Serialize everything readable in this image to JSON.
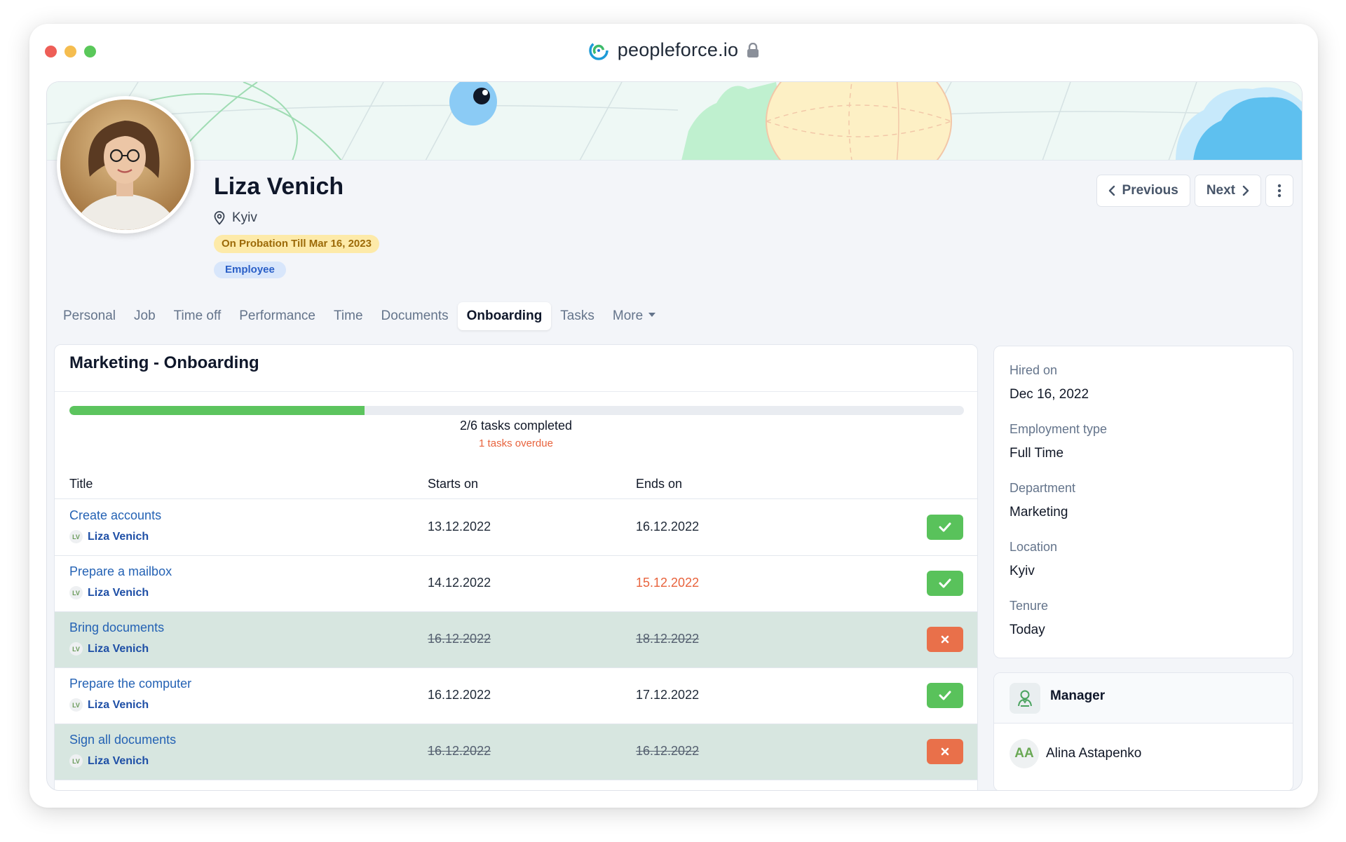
{
  "browser": {
    "url": "peopleforce.io"
  },
  "profile": {
    "name": "Liza Venich",
    "location": "Kyiv",
    "probation": "On Probation Till Mar 16, 2023",
    "type_badge": "Employee"
  },
  "nav": {
    "previous": "Previous",
    "next": "Next"
  },
  "tabs": [
    {
      "label": "Personal"
    },
    {
      "label": "Job"
    },
    {
      "label": "Time off"
    },
    {
      "label": "Performance"
    },
    {
      "label": "Time"
    },
    {
      "label": "Documents"
    },
    {
      "label": "Onboarding"
    },
    {
      "label": "Tasks"
    },
    {
      "label": "More"
    }
  ],
  "active_tab": "Onboarding",
  "onboarding": {
    "title": "Marketing - Onboarding",
    "progress_fraction": 0.33,
    "progress_text": "2/6 tasks completed",
    "overdue_text": "1 tasks overdue",
    "columns": {
      "title": "Title",
      "starts": "Starts on",
      "ends": "Ends on"
    },
    "tasks": [
      {
        "title": "Create accounts",
        "assignee_initials": "LV",
        "assignee": "Liza Venich",
        "starts": "13.12.2022",
        "ends": "16.12.2022",
        "status": "done"
      },
      {
        "title": "Prepare a mailbox",
        "assignee_initials": "LV",
        "assignee": "Liza Venich",
        "starts": "14.12.2022",
        "ends": "15.12.2022",
        "status": "done",
        "ends_overdue": true
      },
      {
        "title": "Bring documents",
        "assignee_initials": "LV",
        "assignee": "Liza Venich",
        "starts": "16.12.2022",
        "ends": "18.12.2022",
        "status": "cancelled"
      },
      {
        "title": "Prepare the computer",
        "assignee_initials": "LV",
        "assignee": "Liza Venich",
        "starts": "16.12.2022",
        "ends": "17.12.2022",
        "status": "done"
      },
      {
        "title": "Sign all documents",
        "assignee_initials": "LV",
        "assignee": "Liza Venich",
        "starts": "16.12.2022",
        "ends": "16.12.2022",
        "status": "cancelled"
      }
    ]
  },
  "employment": {
    "hired_label": "Hired on",
    "hired_value": "Dec 16, 2022",
    "type_label": "Employment type",
    "type_value": "Full Time",
    "dept_label": "Department",
    "dept_value": "Marketing",
    "loc_label": "Location",
    "loc_value": "Kyiv",
    "tenure_label": "Tenure",
    "tenure_value": "Today"
  },
  "manager": {
    "title": "Manager",
    "initials": "AA",
    "name": "Alina Astapenko"
  },
  "colors": {
    "accent_green": "#5cc45e",
    "overdue": "#e8633d",
    "link": "#2462b4",
    "cancel": "#e9704a"
  },
  "icons": {
    "logo": "peopleforce-logo-icon",
    "lock": "lock-icon",
    "location": "map-pin-icon",
    "check": "check-icon",
    "cross": "close-icon",
    "manager": "manager-icon"
  }
}
